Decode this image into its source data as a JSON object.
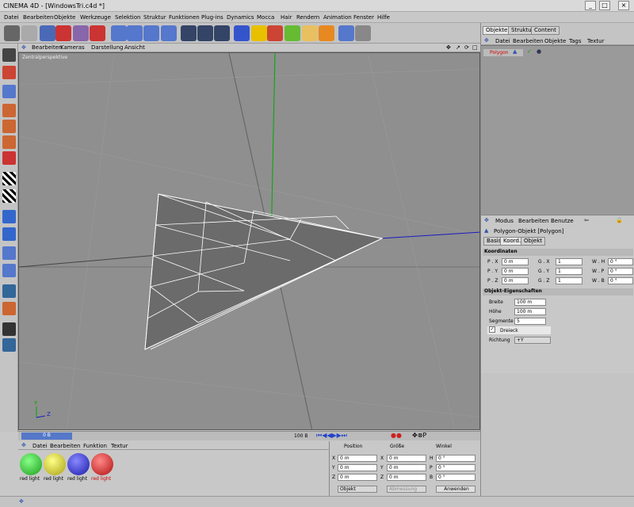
{
  "window": {
    "title": "CINEMA 4D - [WindowsTri.c4d *]"
  },
  "menu": [
    "Datei",
    "Bearbeiten",
    "Objekte",
    "Werkzeuge",
    "Selektion",
    "Struktur",
    "Funktionen",
    "Plug-ins",
    "Dynamics",
    "Mocca",
    "Hair",
    "Rendern",
    "Animation",
    "Fenster",
    "Hilfe"
  ],
  "viewport": {
    "menu": [
      "Bearbeiten",
      "Kameras",
      "Darstellung",
      "Ansicht"
    ],
    "label": "Zentralperspektive"
  },
  "timeline": {
    "start": "0 B",
    "end": "100 B"
  },
  "objects": {
    "tabs": [
      "Objekte",
      "Struktur",
      "Content"
    ],
    "menu": [
      "Datei",
      "Bearbeiten",
      "Objekte",
      "Tags",
      "Textur"
    ],
    "item": "Polygon"
  },
  "attributes": {
    "menu": [
      "Modus",
      "Bearbeiten",
      "Benutze"
    ],
    "title": "Polygon-Objekt [Polygon]",
    "tabs": [
      "Basis",
      "Koord.",
      "Objekt"
    ],
    "coords_header": "Koordinaten",
    "rows": [
      [
        "P . X",
        "0 m",
        "G . X",
        "1",
        "W . H",
        "0 °"
      ],
      [
        "P . Y",
        "0 m",
        "G . Y",
        "1",
        "W . P",
        "0 °"
      ],
      [
        "P . Z",
        "0 m",
        "G . Z",
        "1",
        "W . B",
        "0 °"
      ]
    ],
    "props_header": "Objekt-Eigenschaften",
    "breite_label": "Breite",
    "breite": "100 m",
    "hoehe_label": "Höhe",
    "hoehe": "100 m",
    "seg_label": "Segmente",
    "segmente": "5",
    "dreieck": "Dreieck",
    "richtung_label": "Richtung",
    "richtung": "+Y"
  },
  "materials": {
    "menu": [
      "Datei",
      "Bearbeiten",
      "Funktion",
      "Textur"
    ],
    "items": [
      "red light",
      "red light",
      "red light",
      "red light"
    ]
  },
  "coords": {
    "headers": [
      "Position",
      "Größe",
      "Winkel"
    ],
    "rows": [
      [
        "X",
        "0 m",
        "X",
        "0 m",
        "H",
        "0 °"
      ],
      [
        "Y",
        "0 m",
        "Y",
        "0 m",
        "P",
        "0 °"
      ],
      [
        "Z",
        "0 m",
        "Z",
        "0 m",
        "B",
        "0 °"
      ]
    ],
    "mode": "Objekt",
    "mode2": "Abmessung",
    "apply": "Anwenden"
  }
}
